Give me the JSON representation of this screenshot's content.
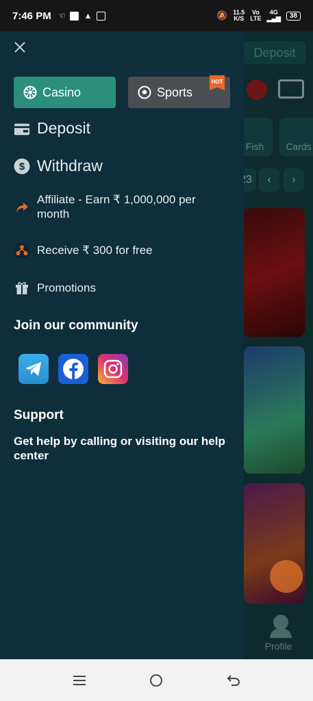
{
  "status_bar": {
    "time": "7:46 PM",
    "speed_top": "11.5",
    "speed_unit": "K/S",
    "net_label_top": "Vo",
    "net_label_bottom": "LTE",
    "net_gen": "4G",
    "battery": "38"
  },
  "drawer": {
    "casino_label": "Casino",
    "sports_label": "Sports",
    "hot_badge": "HOT",
    "menu": {
      "deposit": "Deposit",
      "withdraw": "Withdraw",
      "affiliate": "Affiliate - Earn ₹ 1,000,000 per month",
      "receive": "Receive ₹ 300 for free",
      "promotions": "Promotions"
    },
    "community_title": "Join our community",
    "support_title": "Support",
    "support_text": "Get help by calling or visiting our help center"
  },
  "background_app": {
    "deposit_label": "Deposit",
    "tab_fish": "Fish",
    "tab_cards": "Cards",
    "pager_number": "23",
    "profile_label": "Profile"
  },
  "colors": {
    "drawer_bg": "#0d2e3a",
    "casino_accent": "#2b8f7a",
    "hot_badge": "#e8682a"
  }
}
